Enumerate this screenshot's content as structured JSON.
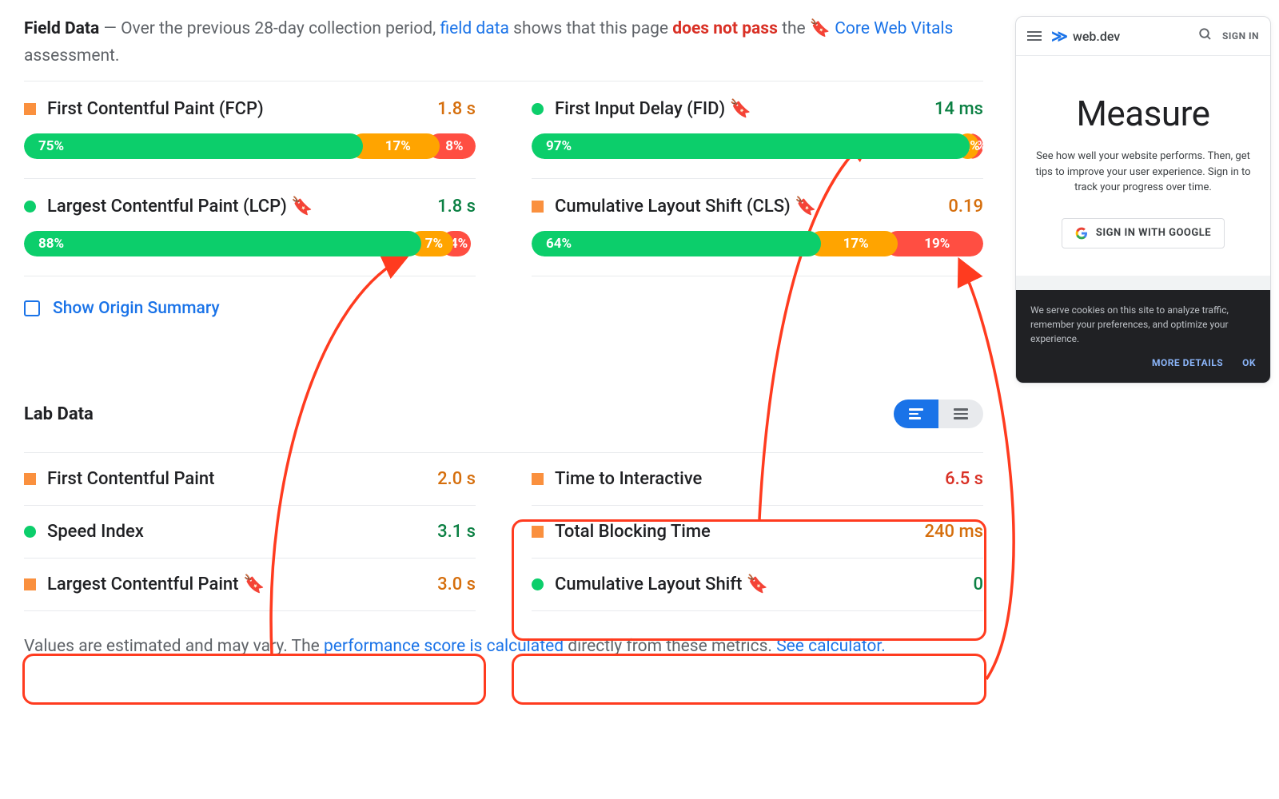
{
  "field": {
    "label": "Field Data",
    "intro1": " — Over the previous 28-day collection period, ",
    "link1": "field data",
    "intro2": " shows that this page ",
    "fail": "does not pass",
    "intro3": " the ",
    "cwv": "Core Web Vitals",
    "intro4": " assessment."
  },
  "metrics": [
    {
      "name": "First Contentful Paint (FCP)",
      "value": "1.8 s",
      "valClass": "val-orange",
      "shape": "square",
      "bookmark": false,
      "g": 75,
      "o": 17,
      "r": 8
    },
    {
      "name": "First Input Delay (FID)",
      "value": "14 ms",
      "valClass": "val-green",
      "shape": "circle",
      "bookmark": true,
      "g": 97,
      "o": 2,
      "r": 1
    },
    {
      "name": "Largest Contentful Paint (LCP)",
      "value": "1.8 s",
      "valClass": "val-green",
      "shape": "circle",
      "bookmark": true,
      "g": 88,
      "o": 7,
      "r": 4
    },
    {
      "name": "Cumulative Layout Shift (CLS)",
      "value": "0.19",
      "valClass": "val-orange",
      "shape": "square",
      "bookmark": true,
      "g": 64,
      "o": 17,
      "r": 19
    }
  ],
  "showOrigin": "Show Origin Summary",
  "lab": {
    "title": "Lab Data"
  },
  "labMetrics": [
    {
      "name": "First Contentful Paint",
      "value": "2.0 s",
      "valClass": "val-orange",
      "shape": "square",
      "bookmark": false
    },
    {
      "name": "Time to Interactive",
      "value": "6.5 s",
      "valClass": "val-red",
      "shape": "square",
      "bookmark": false
    },
    {
      "name": "Speed Index",
      "value": "3.1 s",
      "valClass": "val-green",
      "shape": "circle",
      "bookmark": false
    },
    {
      "name": "Total Blocking Time",
      "value": "240 ms",
      "valClass": "val-orange",
      "shape": "square",
      "bookmark": false
    },
    {
      "name": "Largest Contentful Paint",
      "value": "3.0 s",
      "valClass": "val-orange",
      "shape": "square",
      "bookmark": true
    },
    {
      "name": "Cumulative Layout Shift",
      "value": "0",
      "valClass": "val-green",
      "shape": "circle",
      "bookmark": true
    }
  ],
  "footer": {
    "t1": "Values are estimated and may vary. The ",
    "l1": "performance score is calculated",
    "t2": " directly from these metrics. ",
    "l2": "See calculator."
  },
  "phone": {
    "brand": "web.dev",
    "signin": "SIGN IN",
    "title": "Measure",
    "desc": "See how well your website performs. Then, get tips to improve your user experience. Sign in to track your progress over time.",
    "gbtn": "SIGN IN WITH GOOGLE",
    "cookie": "We serve cookies on this site to analyze traffic, remember your preferences, and optimize your experience.",
    "more": "MORE DETAILS",
    "ok": "OK"
  }
}
